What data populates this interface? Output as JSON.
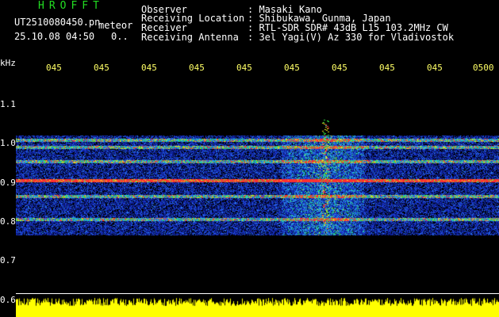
{
  "header": {
    "brand": "HROFFT",
    "filename": "UT2510080450.pn",
    "meteor_label": "meteor",
    "datetime": "25.10.08 04:50",
    "count_value": "0..",
    "fields": [
      {
        "label": "Observer",
        "value": ": Masaki Kano"
      },
      {
        "label": "Receiving Location",
        "value": ": Shibukawa, Gunma, Japan"
      },
      {
        "label": "Receiver",
        "value": ": RTL-SDR SDR# 43dB L15 103.2MHz CW"
      },
      {
        "label": "Receiving Antenna",
        "value": ": 3el Yagi(V) Az 330 for Vladivostok"
      }
    ]
  },
  "axes": {
    "y_unit": "kHz",
    "y_ticks": [
      "1.1",
      "1.0",
      "0.9",
      "0.8",
      "0.7",
      "0.6"
    ],
    "x_ticks": [
      "045",
      "045",
      "045",
      "045",
      "045",
      "045",
      "045",
      "045",
      "045",
      "0500"
    ]
  },
  "colors": {
    "background": "#000000",
    "header_text": "#ffffff",
    "brand": "#22dd22",
    "time_ticks": "#ffff66",
    "signal_level": "#ffff00"
  },
  "spectrogram": {
    "freq_range_khz": [
      0.6,
      1.15
    ],
    "noise_band_khz": [
      0.765,
      1.02
    ],
    "carrier_lines_khz": [
      0.805,
      0.865,
      0.905,
      0.955,
      0.99,
      1.01
    ],
    "strong_carrier_khz": 0.905,
    "meteor_burst_time_fraction": [
      0.55,
      0.72
    ],
    "meteor_peak_time_fraction": 0.64
  }
}
